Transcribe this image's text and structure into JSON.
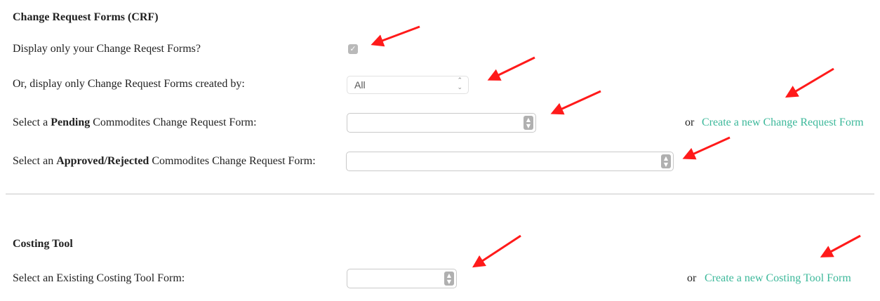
{
  "crf": {
    "title": "Change Request Forms (CRF)",
    "display_own_label": "Display only your Change Reqest Forms?",
    "display_own_checked": true,
    "created_by_label": "Or, display only Change Request Forms created by:",
    "created_by_value": "All",
    "pending_label_prefix": "Select a ",
    "pending_label_bold": "Pending",
    "pending_label_suffix": " Commodites Change Request Form:",
    "or_text": "or",
    "create_link": "Create a new Change Request Form",
    "approved_label_prefix": "Select an ",
    "approved_label_bold": "Approved/Rejected",
    "approved_label_suffix": " Commodites Change Request Form:"
  },
  "costing": {
    "title": "Costing Tool",
    "existing_label": "Select an Existing Costing Tool Form:",
    "or_text": "or",
    "create_link": "Create a new Costing Tool Form"
  },
  "colors": {
    "link": "#3cb89a",
    "annotation_arrow": "#ff1a1a"
  },
  "icons": {
    "checkmark": "check-icon",
    "select_arrows": "updown-chevron-icon",
    "annotation": "red-arrow-annotation"
  }
}
